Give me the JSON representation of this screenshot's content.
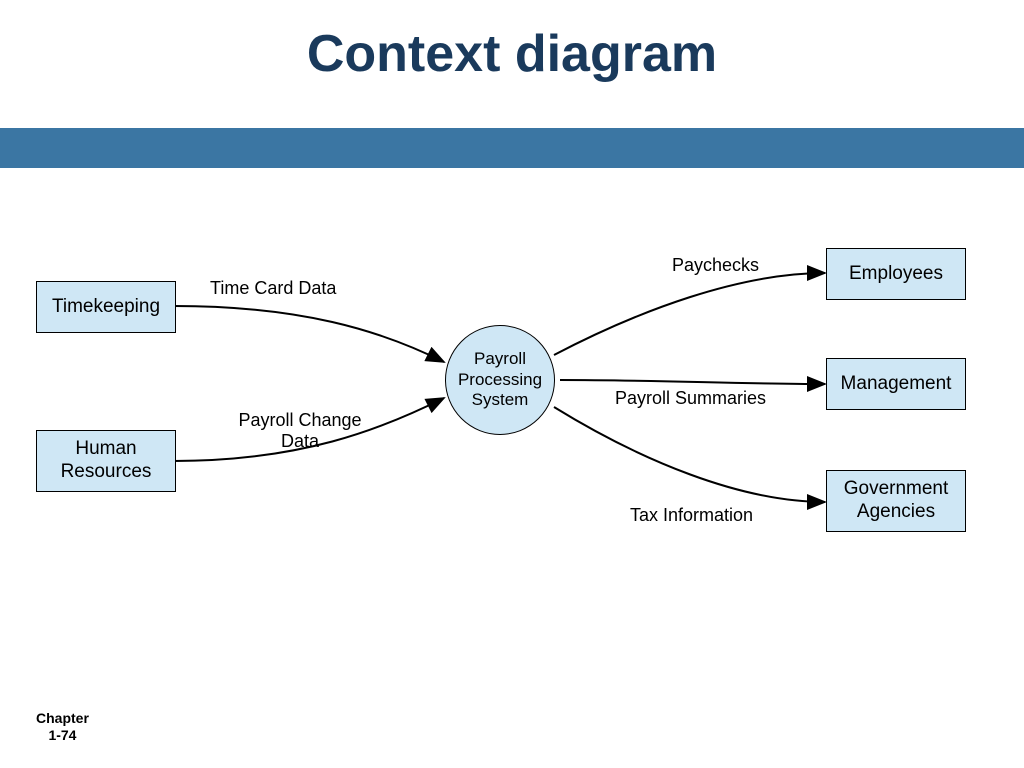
{
  "title": "Context diagram",
  "footer": {
    "line1": "Chapter",
    "line2": "1-74"
  },
  "process": {
    "label": "Payroll Processing System"
  },
  "entities": {
    "timekeeping": "Timekeeping",
    "hr": "Human Resources",
    "employees": "Employees",
    "management": "Management",
    "gov": "Government Agencies"
  },
  "flows": {
    "timecard": "Time Card Data",
    "payrollchange": "Payroll Change Data",
    "paychecks": "Paychecks",
    "summaries": "Payroll Summaries",
    "tax": "Tax Information"
  }
}
